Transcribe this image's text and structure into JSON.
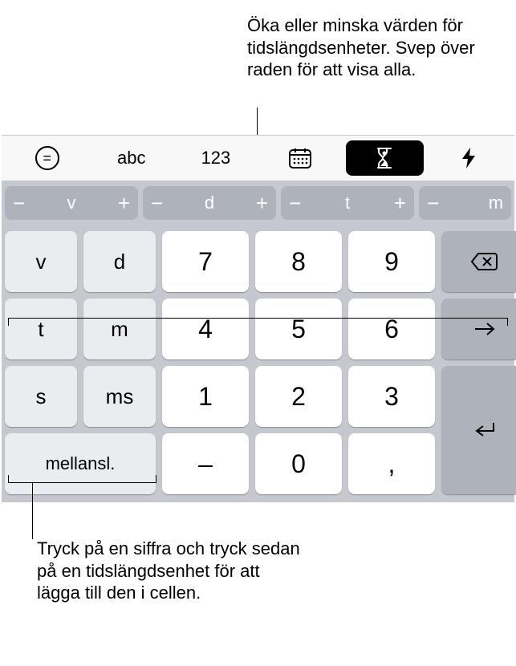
{
  "callouts": {
    "top": "Öka eller minska värden för tidslängdsenheter. Svep över raden för att visa alla.",
    "bottom": "Tryck på en siffra och tryck sedan på en tidslängdsenhet för att lägga till den i cellen."
  },
  "toolbar": {
    "abc": "abc",
    "num": "123"
  },
  "duration_pills": [
    {
      "label": "v"
    },
    {
      "label": "d"
    },
    {
      "label": "t"
    },
    {
      "label": "m"
    }
  ],
  "unit_keys": {
    "v": "v",
    "d": "d",
    "t": "t",
    "m": "m",
    "s": "s",
    "ms": "ms"
  },
  "num_keys": {
    "k7": "7",
    "k8": "8",
    "k9": "9",
    "k4": "4",
    "k5": "5",
    "k6": "6",
    "k1": "1",
    "k2": "2",
    "k3": "3",
    "dash": "–",
    "k0": "0",
    "comma": ","
  },
  "space_label": "mellansl.",
  "icons": {
    "equals": "=",
    "minus": "−",
    "plus": "+"
  }
}
